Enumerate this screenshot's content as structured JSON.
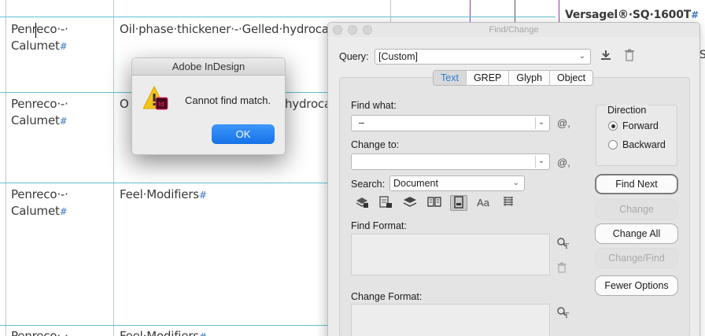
{
  "document": {
    "rows": [
      {
        "col1_line1": "Penreco·-·",
        "col1_line2": "Calumet",
        "col2": "Oil·phase·thickener·-·Gelled·hydroca"
      },
      {
        "col1_line1": "Penreco·-·",
        "col1_line2": "Calumet",
        "col2": "O"
      },
      {
        "col1_line1": "Penreco·-·",
        "col1_line2": "Calumet",
        "col2": "Feel·Modifiers"
      },
      {
        "col1_line1": "Penreco·-·",
        "col1_line2": "",
        "col2": "Feel·Modifiers"
      }
    ],
    "row2_col2_tail": "hydroca",
    "top_right_cell": "Versagel®·SQ·1600T",
    "far_right_letter": "S",
    "pilcrow": "#"
  },
  "alert": {
    "title": "Adobe InDesign",
    "message": "Cannot find match.",
    "ok_label": "OK",
    "badge": "Id"
  },
  "find_change": {
    "title": "Find/Change",
    "query_label": "Query:",
    "query_value": "[Custom]",
    "tabs": [
      {
        "label": "Text",
        "active": true
      },
      {
        "label": "GREP",
        "active": false
      },
      {
        "label": "Glyph",
        "active": false
      },
      {
        "label": "Object",
        "active": false
      }
    ],
    "find_what_label": "Find what:",
    "find_what_value": "–",
    "change_to_label": "Change to:",
    "change_to_value": "",
    "special_char_glyph": "@,",
    "search_label": "Search:",
    "search_value": "Document",
    "direction": {
      "label": "Direction",
      "forward": "Forward",
      "backward": "Backward",
      "selected": "Forward"
    },
    "buttons": {
      "find_next": "Find Next",
      "change": "Change",
      "change_all": "Change All",
      "change_find": "Change/Find",
      "fewer_options": "Fewer Options"
    },
    "find_format_label": "Find Format:",
    "change_format_label": "Change Format:",
    "case_sensitive_glyph": "Aa"
  },
  "colors": {
    "table_line": "#5fc3d3",
    "pilcrow": "#3a78c2",
    "ok_button": "#1572e8",
    "active_tab_text": "#2a7ed8"
  }
}
